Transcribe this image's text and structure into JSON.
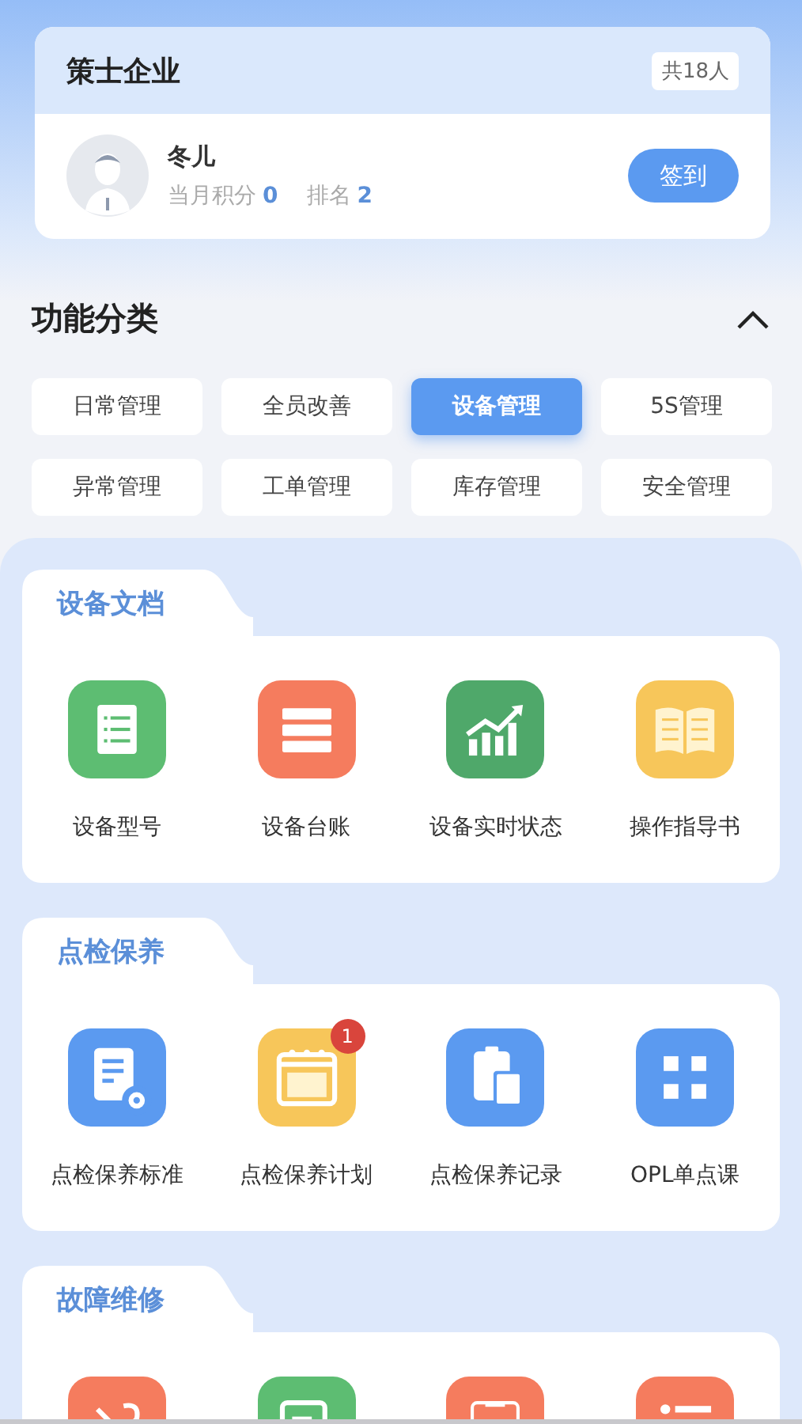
{
  "org": {
    "name": "策士企业",
    "count": "共18人"
  },
  "user": {
    "name": "冬儿",
    "points_label": "当月积分",
    "points": "0",
    "rank_label": "排名",
    "rank": "2",
    "checkin": "签到"
  },
  "categories": {
    "title": "功能分类",
    "expanded": true,
    "items": [
      {
        "label": "日常管理",
        "selected": false
      },
      {
        "label": "全员改善",
        "selected": false
      },
      {
        "label": "设备管理",
        "selected": true
      },
      {
        "label": "5S管理",
        "selected": false
      },
      {
        "label": "异常管理",
        "selected": false
      },
      {
        "label": "工单管理",
        "selected": false
      },
      {
        "label": "库存管理",
        "selected": false
      },
      {
        "label": "安全管理",
        "selected": false
      }
    ]
  },
  "sections": [
    {
      "title": "设备文档",
      "items": [
        {
          "label": "设备型号",
          "kind": "list",
          "color": "#5dbd72"
        },
        {
          "label": "设备台账",
          "kind": "server",
          "color": "#f57c5e"
        },
        {
          "label": "设备实时状态",
          "kind": "chart",
          "color": "#4fa86a"
        },
        {
          "label": "操作指导书",
          "kind": "book",
          "color": "#f7c65a"
        }
      ]
    },
    {
      "title": "点检保养",
      "items": [
        {
          "label": "点检保养标准",
          "kind": "docgear",
          "color": "#5b9af0"
        },
        {
          "label": "点检保养计划",
          "kind": "calendar",
          "color": "#f7c65a",
          "badge": "1"
        },
        {
          "label": "点检保养记录",
          "kind": "clipboard",
          "color": "#5b9af0"
        },
        {
          "label": "OPL单点课",
          "kind": "grid",
          "color": "#5b9af0"
        }
      ]
    },
    {
      "title": "故障维修",
      "items": [
        {
          "kind": "wrench",
          "color": "#f57c5e"
        },
        {
          "kind": "edit",
          "color": "#5dbd72"
        },
        {
          "kind": "clipboard2",
          "color": "#f57c5e"
        },
        {
          "kind": "list2",
          "color": "#f57c5e"
        }
      ]
    }
  ]
}
